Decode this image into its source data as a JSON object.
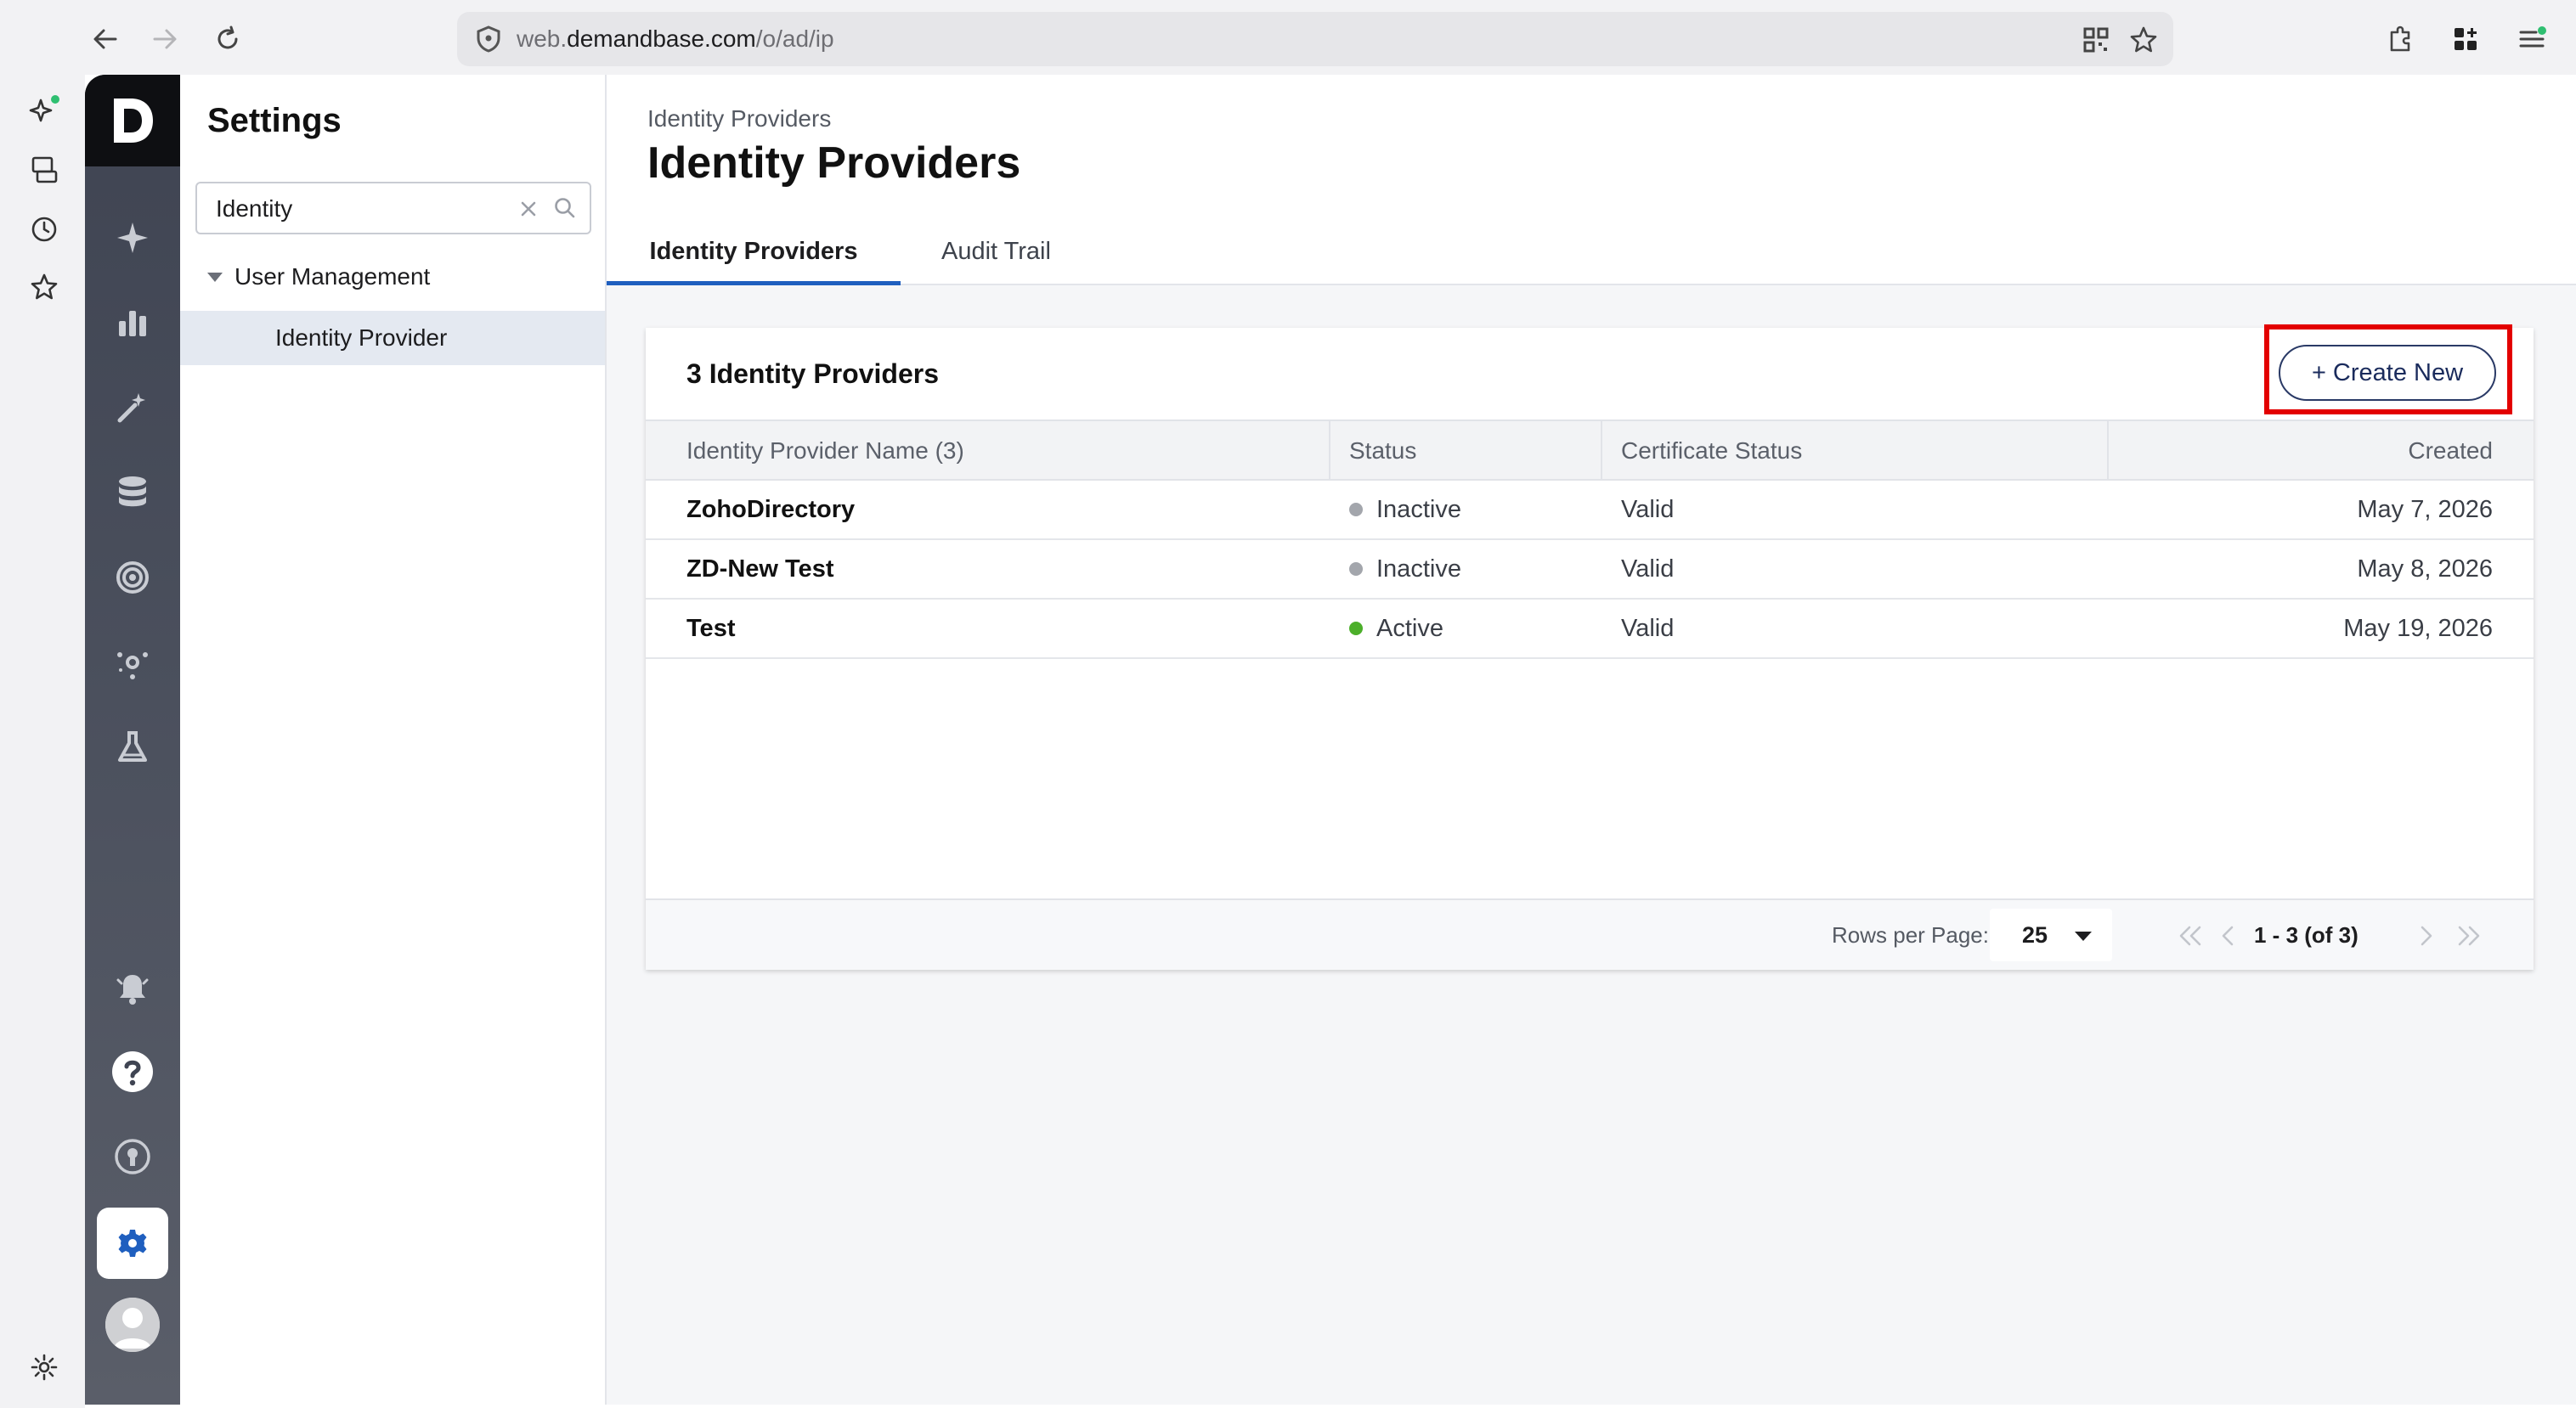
{
  "browser": {
    "url_prefix": "web.",
    "url_domain": "demandbase.com",
    "url_path": "/o/ad/ip"
  },
  "settings": {
    "title": "Settings",
    "search_value": "Identity",
    "tree_group": "User Management",
    "tree_item": "Identity Provider"
  },
  "header": {
    "breadcrumb": "Identity Providers",
    "title": "Identity Providers",
    "tabs": [
      {
        "label": "Identity Providers",
        "active": true
      },
      {
        "label": "Audit Trail",
        "active": false
      }
    ]
  },
  "card": {
    "title": "3 Identity Providers",
    "create_button": "+ Create New"
  },
  "table": {
    "columns": [
      "Identity Provider Name (3)",
      "Status",
      "Certificate Status",
      "Created"
    ],
    "rows": [
      {
        "name": "ZohoDirectory",
        "status": "Inactive",
        "status_color": "#a3a6ac",
        "certificate": "Valid",
        "created": "May 7, 2026"
      },
      {
        "name": "ZD-New Test",
        "status": "Inactive",
        "status_color": "#a3a6ac",
        "certificate": "Valid",
        "created": "May 8, 2026"
      },
      {
        "name": "Test",
        "status": "Active",
        "status_color": "#4caf2a",
        "certificate": "Valid",
        "created": "May 19, 2026"
      }
    ]
  },
  "pagination": {
    "rows_per_page_label": "Rows per Page:",
    "rows_per_page_value": "25",
    "range": "1 - 3 (of 3)"
  },
  "colors": {
    "accent_tab": "#1f5fbf",
    "highlight": "#e30000",
    "rail_settings_icon": "#1f5fbf"
  }
}
